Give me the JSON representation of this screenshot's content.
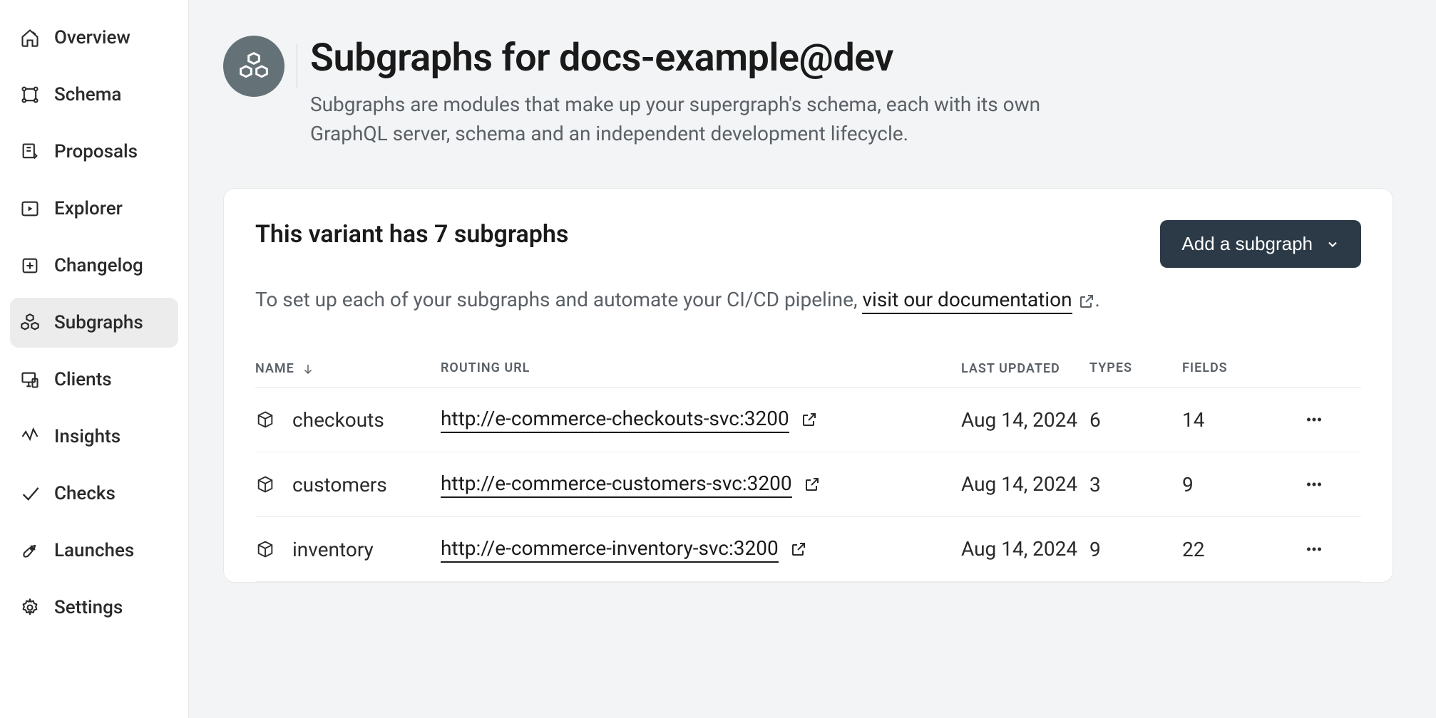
{
  "sidebar": {
    "items": [
      {
        "label": "Overview"
      },
      {
        "label": "Schema"
      },
      {
        "label": "Proposals"
      },
      {
        "label": "Explorer"
      },
      {
        "label": "Changelog"
      },
      {
        "label": "Subgraphs"
      },
      {
        "label": "Clients"
      },
      {
        "label": "Insights"
      },
      {
        "label": "Checks"
      },
      {
        "label": "Launches"
      },
      {
        "label": "Settings"
      }
    ]
  },
  "header": {
    "title": "Subgraphs for docs-example@dev",
    "description": "Subgraphs are modules that make up your supergraph's schema, each with its own GraphQL server, schema and an independent development lifecycle."
  },
  "panel": {
    "title": "This variant has 7 subgraphs",
    "add_button_label": "Add a subgraph",
    "desc_prefix": "To set up each of your subgraphs and automate your CI/CD pipeline, ",
    "desc_link": "visit our documentation",
    "desc_suffix": "."
  },
  "table": {
    "headers": {
      "name": "NAME",
      "routing_url": "ROUTING URL",
      "last_updated": "LAST UPDATED",
      "types": "TYPES",
      "fields": "FIELDS"
    },
    "rows": [
      {
        "name": "checkouts",
        "url": "http://e-commerce-checkouts-svc:3200",
        "updated": "Aug 14, 2024",
        "types": "6",
        "fields": "14"
      },
      {
        "name": "customers",
        "url": "http://e-commerce-customers-svc:3200",
        "updated": "Aug 14, 2024",
        "types": "3",
        "fields": "9"
      },
      {
        "name": "inventory",
        "url": "http://e-commerce-inventory-svc:3200",
        "updated": "Aug 14, 2024",
        "types": "9",
        "fields": "22"
      }
    ]
  }
}
